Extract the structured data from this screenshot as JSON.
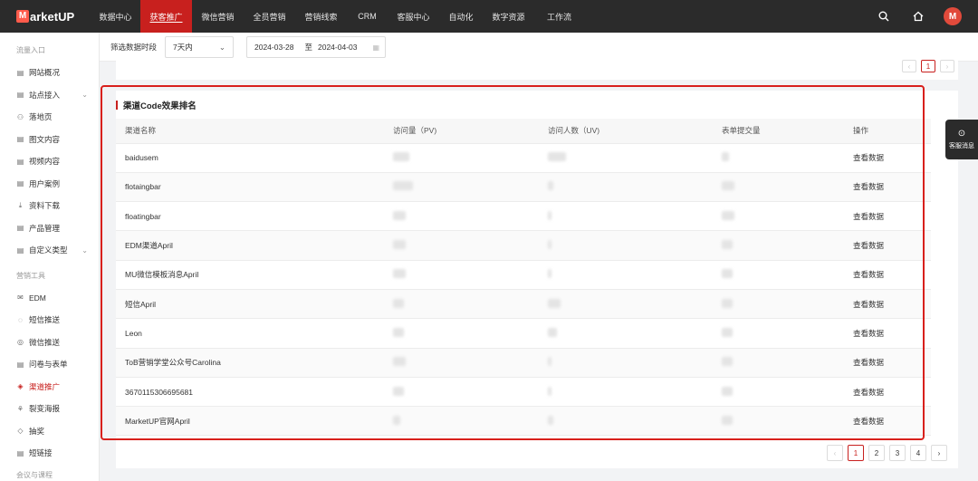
{
  "brand": {
    "logo_letter": "M",
    "logo_text": "arketUP"
  },
  "nav": {
    "items": [
      {
        "label": "数据中心",
        "width": 55
      },
      {
        "label": "获客推广",
        "width": 57,
        "active": true
      },
      {
        "label": "微信营销",
        "width": 57
      },
      {
        "label": "全员营销",
        "width": 57
      },
      {
        "label": "营销线索",
        "width": 57
      },
      {
        "label": "CRM",
        "width": 45
      },
      {
        "label": "客服中心",
        "width": 57
      },
      {
        "label": "自动化",
        "width": 48
      },
      {
        "label": "数字资源",
        "width": 57
      },
      {
        "label": "工作流",
        "width": 55
      }
    ],
    "avatar_letter": "M"
  },
  "sidebar": {
    "group1": "流量入口",
    "items1": [
      {
        "label": "网站概况",
        "icon": "▤"
      },
      {
        "label": "站点接入",
        "icon": "▤",
        "chev": "⌄"
      },
      {
        "label": "落地页",
        "icon": "⚇"
      },
      {
        "label": "图文内容",
        "icon": "▤"
      },
      {
        "label": "视频内容",
        "icon": "▤"
      },
      {
        "label": "用户案例",
        "icon": "▤"
      },
      {
        "label": "资料下载",
        "icon": "⤓"
      },
      {
        "label": "产品管理",
        "icon": "▤"
      },
      {
        "label": "自定义类型",
        "icon": "▤",
        "chev": "⌄"
      }
    ],
    "group2": "营销工具",
    "items2": [
      {
        "label": "EDM",
        "icon": "✉"
      },
      {
        "label": "短信推送",
        "icon": "◌"
      },
      {
        "label": "微信推送",
        "icon": "◎"
      },
      {
        "label": "问卷与表单",
        "icon": "▤"
      },
      {
        "label": "渠道推广",
        "icon": "◈",
        "active": true
      },
      {
        "label": "裂变海报",
        "icon": "⚘"
      },
      {
        "label": "抽奖",
        "icon": "◇"
      },
      {
        "label": "短链接",
        "icon": "▤"
      }
    ],
    "group3": "会议与课程"
  },
  "filter": {
    "label": "筛选数据时段",
    "period": "7天内",
    "start_date": "2024-03-28",
    "to": "至",
    "end_date": "2024-04-03"
  },
  "top_pager": {
    "current": "1"
  },
  "card": {
    "title": "渠道Code效果排名",
    "columns": [
      "渠道名称",
      "访问量（PV)",
      "访问人数（UV)",
      "表单提交量",
      "操作"
    ],
    "rows": [
      {
        "name": "baidusem",
        "action": "查看数据"
      },
      {
        "name": "flotaingbar",
        "action": "查看数据"
      },
      {
        "name": "floatingbar",
        "action": "查看数据"
      },
      {
        "name": "EDM渠道April",
        "action": "查看数据"
      },
      {
        "name": "MU微信模板消息April",
        "action": "查看数据"
      },
      {
        "name": "短信April",
        "action": "查看数据"
      },
      {
        "name": "Leon",
        "action": "查看数据"
      },
      {
        "name": "ToB营销学堂公众号Carolina",
        "action": "查看数据"
      },
      {
        "name": "3670115306695681",
        "action": "查看数据"
      },
      {
        "name": "MarketUP官网April",
        "action": "查看数据"
      }
    ],
    "pager": [
      "1",
      "2",
      "3",
      "4"
    ],
    "current_page": "1"
  },
  "service": {
    "label": "客服消息",
    "icon": "chat-icon"
  }
}
